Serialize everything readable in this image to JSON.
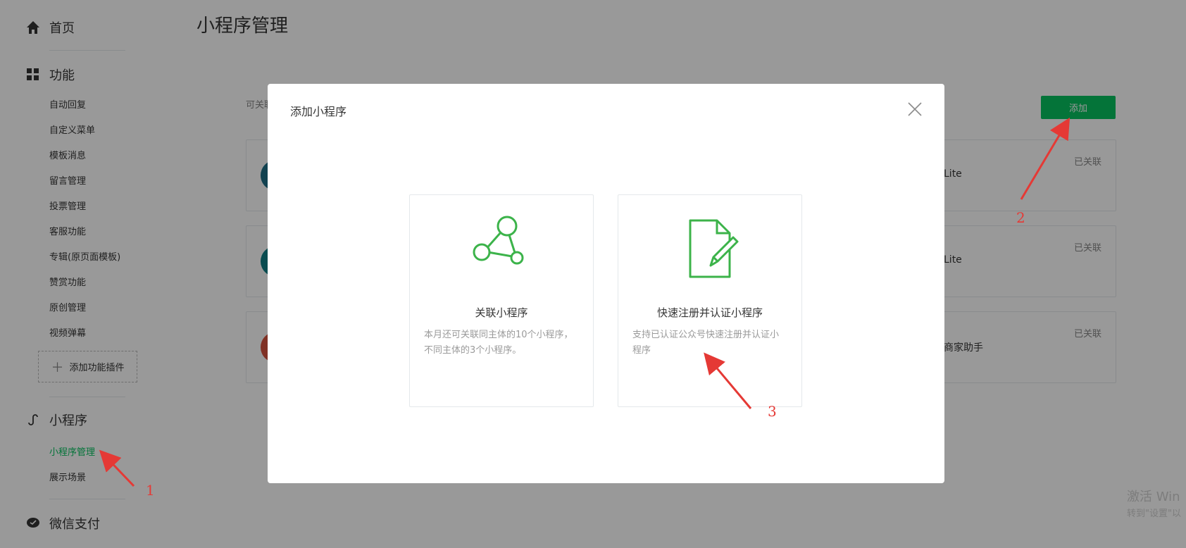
{
  "sidebar": {
    "home_label": "首页",
    "features_label": "功能",
    "feature_items": [
      "自动回复",
      "自定义菜单",
      "模板消息",
      "留言管理",
      "投票管理",
      "客服功能",
      "专辑(原页面模板)",
      "赞赏功能",
      "原创管理",
      "视频弹幕"
    ],
    "add_plugin_label": "添加功能插件",
    "miniprogram_label": "小程序",
    "miniprogram_items": [
      "小程序管理",
      "展示场景"
    ],
    "wechat_pay_label": "微信支付"
  },
  "main": {
    "title": "小程序管理",
    "desc": "可关联",
    "add_button": "添加",
    "rows": [
      {
        "name": "Lite",
        "status": "已关联",
        "avatar_color": "#1f6e86"
      },
      {
        "name": "Lite",
        "status": "已关联",
        "avatar_color": "#0f7f86"
      },
      {
        "name": "商家助手",
        "status": "已关联",
        "avatar_color": "#d5533e"
      }
    ]
  },
  "dialog": {
    "title": "添加小程序",
    "options": [
      {
        "icon": "network-icon",
        "title": "关联小程序",
        "desc": "本月还可关联同主体的10个小程序，不同主体的3个小程序。"
      },
      {
        "icon": "document-pen-icon",
        "title": "快速注册并认证小程序",
        "desc": "支持已认证公众号快速注册并认证小程序"
      }
    ]
  },
  "annotations": [
    "1",
    "2",
    "3"
  ],
  "watermark": {
    "line1": "激活 Win",
    "line2": "转到\"设置\"以"
  },
  "colors": {
    "accent": "#07c160",
    "annotation": "#e53935",
    "icon_green": "#3cb34a"
  }
}
